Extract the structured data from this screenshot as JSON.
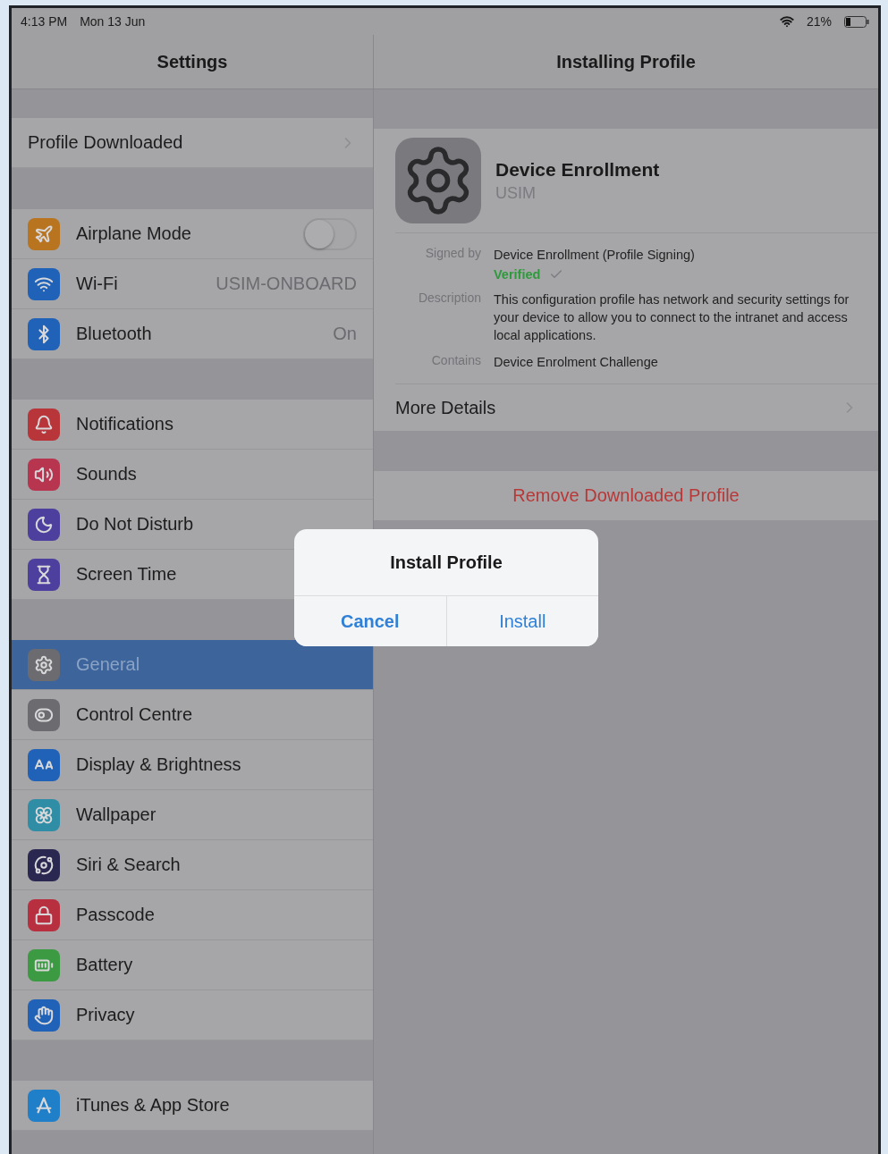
{
  "status_bar": {
    "time": "4:13 PM",
    "date": "Mon 13 Jun",
    "battery": "21%"
  },
  "sidebar": {
    "title": "Settings",
    "sections": [
      {
        "items": [
          {
            "label": "Profile Downloaded",
            "kind": "link",
            "selected": false
          }
        ]
      },
      {
        "items": [
          {
            "label": "Airplane Mode",
            "kind": "toggle",
            "on": false,
            "selected": false,
            "color": "#b8741f"
          },
          {
            "label": "Wi-Fi",
            "kind": "value",
            "value": "USIM-ONBOARD",
            "selected": false,
            "color": "#1f62b8"
          },
          {
            "label": "Bluetooth",
            "kind": "value",
            "value": "On",
            "selected": false,
            "color": "#1f62b8"
          }
        ]
      },
      {
        "items": [
          {
            "label": "Notifications",
            "kind": "plain",
            "selected": false,
            "color": "#b8353a"
          },
          {
            "label": "Sounds",
            "kind": "plain",
            "selected": false,
            "color": "#b83550"
          },
          {
            "label": "Do Not Disturb",
            "kind": "plain",
            "selected": false,
            "color": "#4c3f9e"
          },
          {
            "label": "Screen Time",
            "kind": "plain",
            "selected": false,
            "color": "#4c3f9e"
          }
        ]
      },
      {
        "items": [
          {
            "label": "General",
            "kind": "plain",
            "selected": true,
            "color": "#6c6c70"
          },
          {
            "label": "Control Centre",
            "kind": "plain",
            "selected": false,
            "color": "#6c6c70"
          },
          {
            "label": "Display & Brightness",
            "kind": "plain",
            "selected": false,
            "color": "#1f62b8"
          },
          {
            "label": "Wallpaper",
            "kind": "plain",
            "selected": false,
            "color": "#2f8ea6"
          },
          {
            "label": "Siri & Search",
            "kind": "plain",
            "selected": false,
            "color": "#2a2850"
          },
          {
            "label": "Passcode",
            "kind": "plain",
            "selected": false,
            "color": "#b82f40"
          },
          {
            "label": "Battery",
            "kind": "plain",
            "selected": false,
            "color": "#3c9a43"
          },
          {
            "label": "Privacy",
            "kind": "plain",
            "selected": false,
            "color": "#1f62b8"
          }
        ]
      },
      {
        "items": [
          {
            "label": "iTunes & App Store",
            "kind": "plain",
            "selected": false,
            "color": "#1f7fc8"
          }
        ]
      }
    ]
  },
  "detail": {
    "title": "Installing Profile",
    "profile": {
      "name": "Device Enrollment",
      "organization": "USIM"
    },
    "fields": [
      {
        "label": "Signed by",
        "value": "Device Enrollment (Profile Signing)",
        "status": "Verified"
      },
      {
        "label": "Description",
        "value": "This configuration profile has network and security settings for your device to allow you to connect to the intranet and access local applications."
      },
      {
        "label": "Contains",
        "value": "Device Enrolment Challenge"
      }
    ],
    "more_details": "More Details",
    "remove": "Remove Downloaded Profile"
  },
  "dialog": {
    "title": "Install Profile",
    "buttons": [
      {
        "label": "Cancel",
        "kind": "cancel"
      },
      {
        "label": "Install",
        "kind": "default"
      }
    ]
  }
}
